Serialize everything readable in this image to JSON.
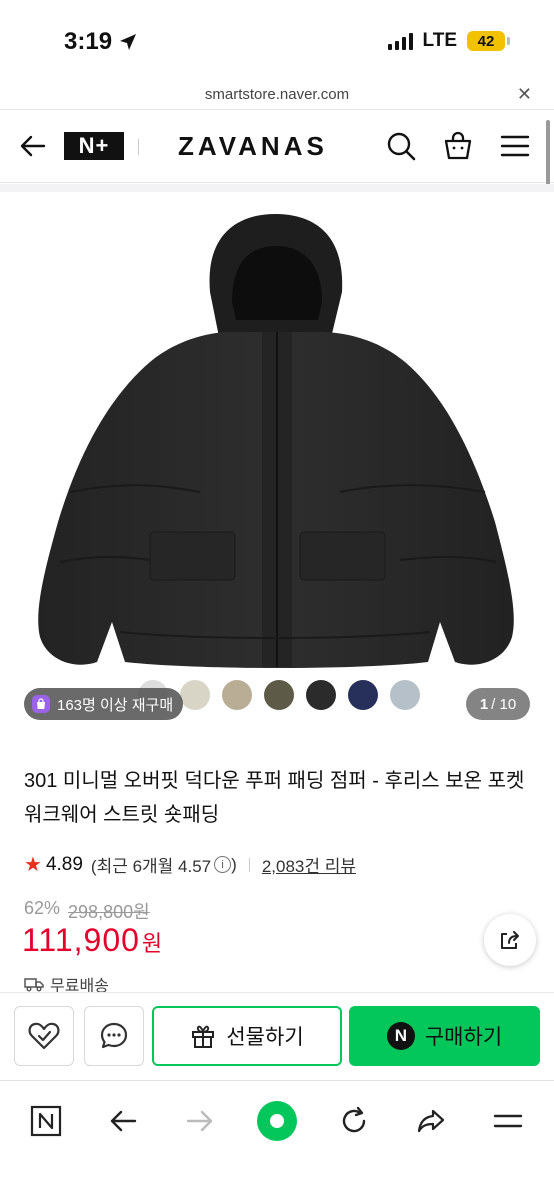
{
  "status_bar": {
    "time": "3:19",
    "network": "LTE",
    "battery": "42"
  },
  "browser": {
    "url": "smartstore.naver.com"
  },
  "header": {
    "nplus_label": "N+",
    "brand": "ZAVANAS"
  },
  "product": {
    "rebuy_badge": "163명 이상 재구매",
    "image_counter_current": "1",
    "image_counter_total": "/ 10",
    "swatches": [
      "#dcdcdc",
      "#d8d4c6",
      "#b9ae95",
      "#5d5a48",
      "#2b2b2b",
      "#26305a",
      "#b6c0c8"
    ],
    "title": "301 미니멀 오버핏 덕다운 푸퍼 패딩 점퍼 - 후리스 보온 포켓 워크웨어 스트릿 숏패딩",
    "rating": "4.89",
    "rating_recent": "(최근 6개월 4.57",
    "rating_info": "i",
    "rating_recent_close": ")",
    "reviews": "2,083건 리뷰",
    "discount": "62%",
    "original_price": "298,800원",
    "price": "111,900",
    "price_unit": "원",
    "shipping": "무료배송"
  },
  "actions": {
    "gift_label": "선물하기",
    "buy_label": "구매하기",
    "buy_badge": "N"
  },
  "colors": {
    "naver_green": "#03c75a",
    "price_red": "#e5002b",
    "star": "#e8301c"
  }
}
